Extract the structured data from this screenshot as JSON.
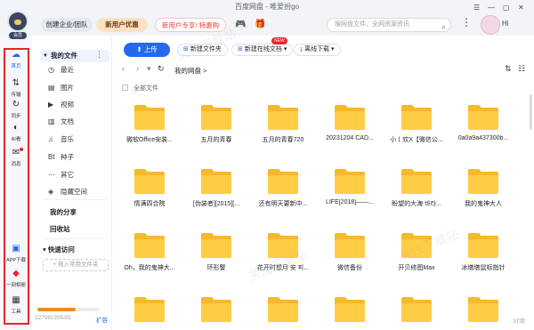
{
  "window": {
    "title": "百度网盘 - 唯爱扮go",
    "controls": [
      "☰",
      "—",
      "▢",
      "✕"
    ]
  },
  "header": {
    "logo_badge": "会员",
    "enterprise_label": "创建企业/团队",
    "newuser_label": "新用户优惠",
    "svip_label": "新用户专享! 特惠购SVIP",
    "search_placeholder": "搜网盘文件、全网资源资讯",
    "greeting": "Hi"
  },
  "rail": {
    "items": [
      {
        "label": "首页",
        "icon": "cloud-icon",
        "glyph": "☁",
        "active": true
      },
      {
        "label": "传输",
        "icon": "transfer-icon",
        "glyph": "⇅",
        "active": false
      },
      {
        "label": "同步",
        "icon": "sync-icon",
        "glyph": "↻",
        "active": false
      },
      {
        "label": "AI看",
        "icon": "ai-icon",
        "glyph": "◐",
        "active": false
      },
      {
        "label": "消息",
        "icon": "message-icon",
        "glyph": "✉",
        "active": false
      }
    ],
    "bottom": [
      {
        "label": "APP下载",
        "icon": "app-download-icon",
        "glyph": "▣"
      },
      {
        "label": "一刻相册",
        "icon": "album-icon",
        "glyph": "◆"
      },
      {
        "label": "工具",
        "icon": "tools-icon",
        "glyph": "▦"
      }
    ]
  },
  "sidebar": {
    "my_files": "我的文件",
    "items": [
      {
        "label": "最近",
        "glyph": "◷"
      },
      {
        "label": "图片",
        "glyph": "▤"
      },
      {
        "label": "视频",
        "glyph": "▶"
      },
      {
        "label": "文档",
        "glyph": "▥"
      },
      {
        "label": "音乐",
        "glyph": "♫"
      },
      {
        "label": "种子",
        "glyph": "Bt"
      },
      {
        "label": "其它",
        "glyph": "⋯"
      },
      {
        "label": "隐藏空间",
        "glyph": "◈"
      }
    ],
    "my_share": "我的分享",
    "recycle": "回收站",
    "quick_access": "快速访问",
    "add_folder": "+ 拖入常用文件夹",
    "storage_text": "1279G/2053G",
    "storage_used_fraction": 0.62,
    "expand": "扩容"
  },
  "toolbar": {
    "upload": "上传",
    "new_folder": "新建文件夹",
    "new_online_doc": "新建在线文档",
    "new_badge": "NEW",
    "offline_download": "离线下载"
  },
  "nav": {
    "breadcrumb": "我的网盘",
    "breadcrumb_sep": ">"
  },
  "list": {
    "select_all": "全部文件",
    "count": "37项"
  },
  "files": [
    "微软Office安装...",
    "五月的青春",
    "五月的青春720",
    "20231204 CAD...",
    "小丨欢X【微信公...",
    "0a0a9a437300b...",
    "情满四合院",
    "[伪装者][2015][...",
    "还有明天要新中...",
    "LIFE[2018]——...",
    "盼望的大海 바라...",
    "我的鬼神大人",
    "Oh，我的鬼神大...",
    "环形警",
    "花开时想月 安 피...",
    "微信备份",
    "开贝修图Max",
    "冰墩墩鼠标指针",
    "",
    "",
    "",
    "",
    "",
    ""
  ],
  "watermarks": [
    "关注下载站",
    "关注下载站",
    "关注下载站"
  ]
}
